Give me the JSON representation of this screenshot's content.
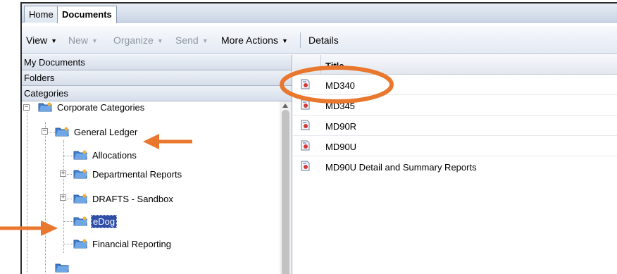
{
  "tabs": {
    "home": "Home",
    "documents": "Documents"
  },
  "toolbar": {
    "view": "View",
    "new": "New",
    "organize": "Organize",
    "send": "Send",
    "more_actions": "More Actions",
    "details": "Details",
    "dropdown_arrow": "▼"
  },
  "accordion": {
    "my_documents": "My Documents",
    "folders": "Folders",
    "categories": "Categories"
  },
  "tree": {
    "root": "Corporate Categories",
    "general_ledger": "General Ledger",
    "allocations": "Allocations",
    "departmental_reports": "Departmental Reports",
    "drafts_sandbox": "DRAFTS - Sandbox",
    "edog": "eDog",
    "financial_reporting": "Financial Reporting"
  },
  "grid": {
    "column_title": "Title",
    "rows": [
      "MD340",
      "MD345",
      "MD90R",
      "MD90U",
      "MD90U Detail and Summary Reports"
    ]
  },
  "colors": {
    "annotation": "#e9772e",
    "selection": "#2e4ea8",
    "folder_blue": "#3f7fcf"
  }
}
